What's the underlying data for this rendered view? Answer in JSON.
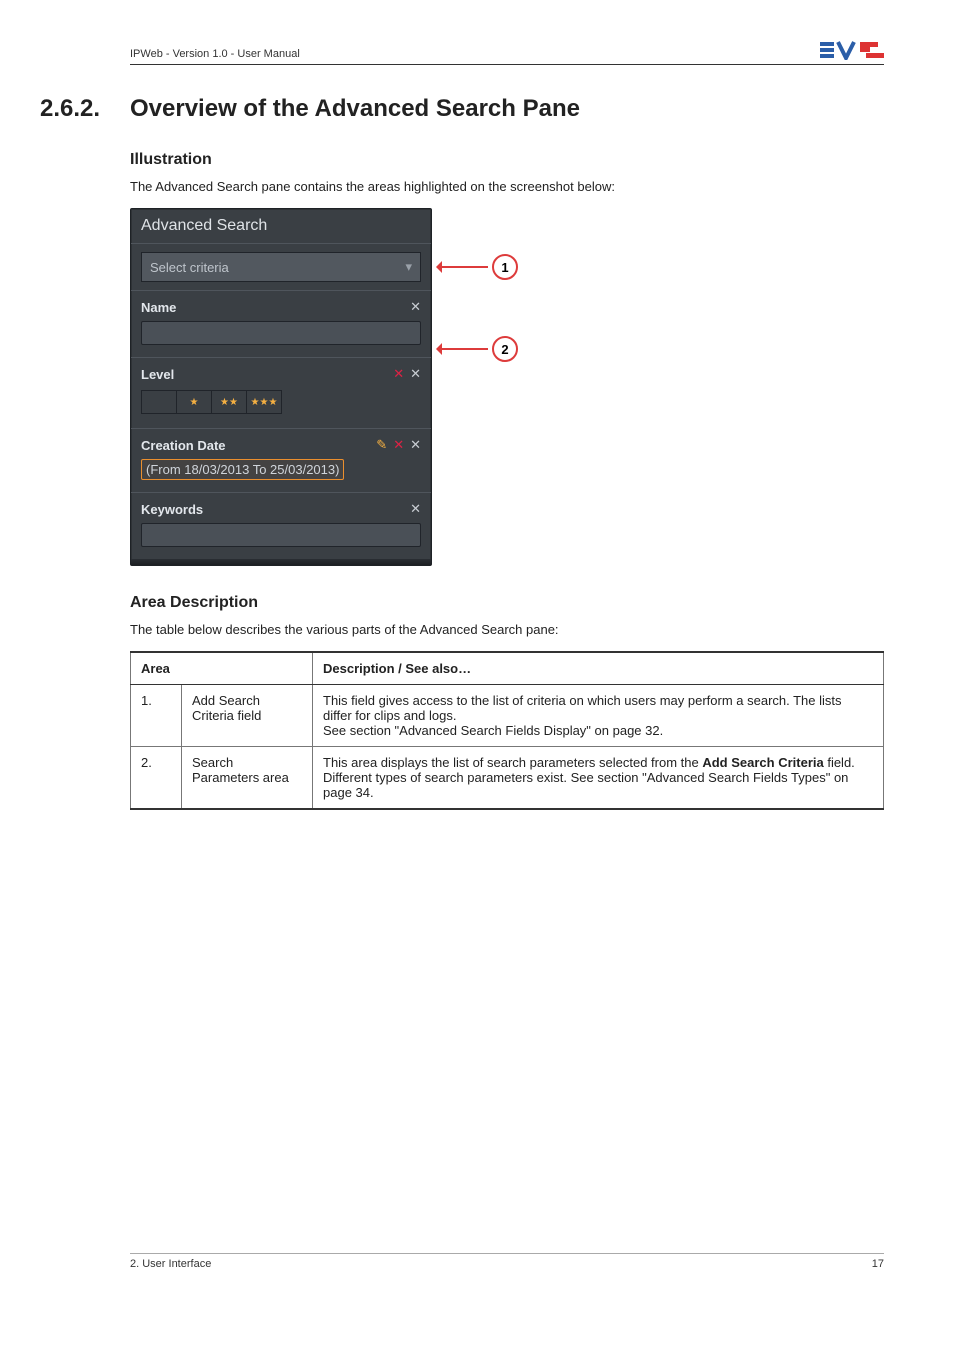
{
  "header": {
    "breadcrumb": "IPWeb - Version 1.0 - User Manual"
  },
  "section": {
    "number": "2.6.2.",
    "title": "Overview of the Advanced Search Pane"
  },
  "illustration": {
    "heading": "Illustration",
    "lead": "The Advanced Search pane contains the areas highlighted on the screenshot below:"
  },
  "panel": {
    "title": "Advanced Search",
    "select_placeholder": "Select criteria",
    "callout1": "1",
    "callout2": "2",
    "blocks": {
      "name": {
        "label": "Name"
      },
      "level": {
        "label": "Level",
        "stars0": " ",
        "stars1": "★",
        "stars2": "★★",
        "stars3": "★★★"
      },
      "creation": {
        "label": "Creation Date",
        "range": "(From 18/03/2013 To 25/03/2013)"
      },
      "keywords": {
        "label": "Keywords"
      }
    }
  },
  "areadesc": {
    "heading": "Area Description",
    "lead": "The table below describes the various parts of the Advanced Search pane:",
    "th_area": "Area",
    "th_desc": "Description / See also…",
    "rows": [
      {
        "num": "1.",
        "name": "Add Search Criteria field",
        "desc_l1": "This field gives access to the list of criteria on which users may perform a search. The lists differ for clips and logs.",
        "desc_l2": "See section \"Advanced Search Fields Display\" on page 32."
      },
      {
        "num": "2.",
        "name": "Search Parameters area",
        "desc_l1a": "This area displays the list of search parameters selected from the ",
        "desc_l1b_bold": "Add Search Criteria",
        "desc_l1c": " field.",
        "desc_l2": "Different types of search parameters exist. See section \"Advanced Search Fields Types\" on page 34."
      }
    ]
  },
  "footer": {
    "left": "2. User Interface",
    "right": "17"
  }
}
